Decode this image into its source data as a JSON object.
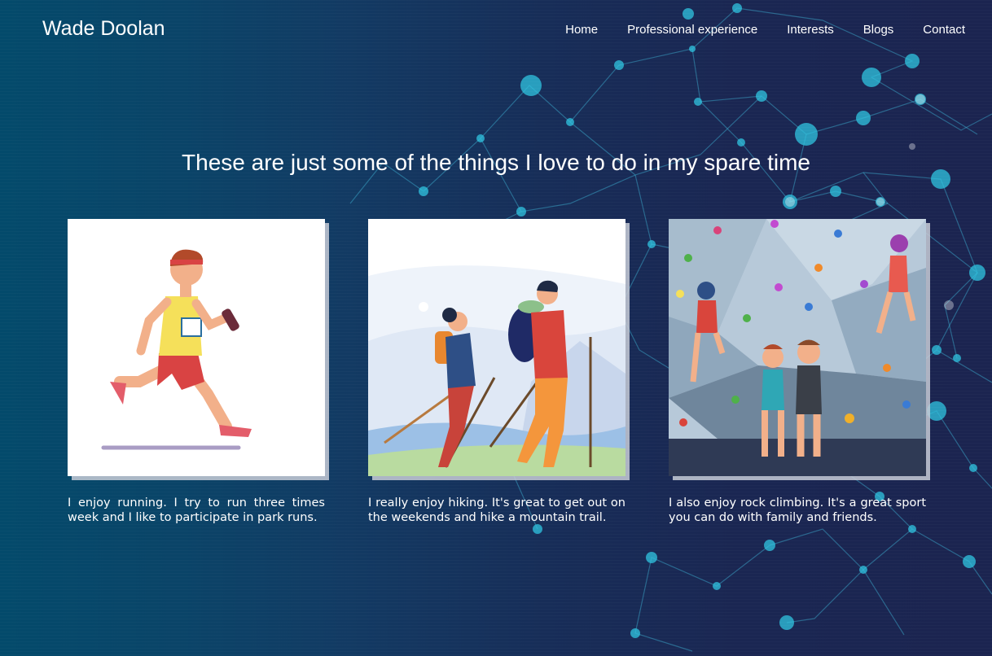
{
  "header": {
    "brand": "Wade Doolan",
    "nav": [
      "Home",
      "Professional experience",
      "Interests",
      "Blogs",
      "Contact"
    ]
  },
  "main": {
    "headline": "These are just some of the things I love to do in my spare time",
    "cards": [
      {
        "image": "runner-illustration",
        "caption": "I enjoy running. I try to run three times week and I like to participate in park runs."
      },
      {
        "image": "hikers-illustration",
        "caption": "I really enjoy hiking. It's great to get out on the weekends and hike a mountain trail."
      },
      {
        "image": "climbing-illustration",
        "caption": "I also enjoy rock climbing. It's a great sport you can do with family and friends."
      }
    ]
  },
  "colors": {
    "background_left": "#034a6b",
    "background_right": "#1b2450",
    "network_accent": "#2fc4e0",
    "text": "#ffffff"
  }
}
